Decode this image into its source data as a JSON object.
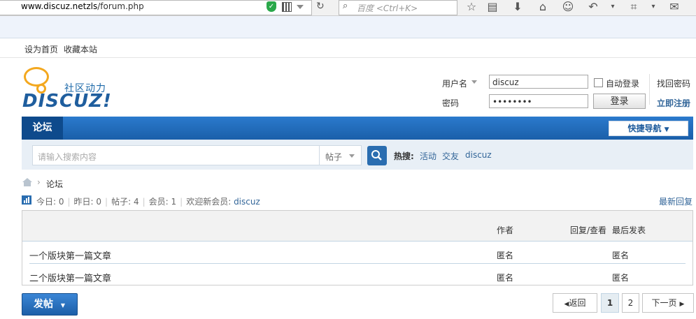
{
  "browser": {
    "url_host": "www.discuz.netzls",
    "url_path": "/forum.php",
    "search_placeholder": "百度 <Ctrl+K>"
  },
  "toplinks": [
    "设为首页",
    "收藏本站"
  ],
  "logo": {
    "slogan": "社区动力",
    "text": "DISCUZ!"
  },
  "login": {
    "username_label": "用户名",
    "username_value": "discuz",
    "password_label": "密码",
    "password_value": "••••••••",
    "autologin_label": "自动登录",
    "login_button": "登录",
    "find_password": "找回密码",
    "register": "立即注册"
  },
  "nav": {
    "active_tab": "论坛",
    "quicknav": "快捷导航"
  },
  "search": {
    "placeholder": "请输入搜索内容",
    "type": "帖子",
    "hot_label": "热搜:",
    "hot_items": [
      "活动",
      "交友",
      "discuz"
    ]
  },
  "breadcrumb": {
    "current": "论坛"
  },
  "stats": {
    "today": "今日: 0",
    "yesterday": "昨日: 0",
    "posts": "帖子: 4",
    "members": "会员: 1",
    "welcome": "欢迎新会员:",
    "new_member": "discuz",
    "latest_reply": "最新回复"
  },
  "table": {
    "headers": {
      "author": "作者",
      "replies": "回复/查看",
      "lastpost": "最后发表"
    },
    "rows": [
      {
        "title": "一个版块第一篇文章",
        "author": "匿名",
        "lastpost": "匿名"
      },
      {
        "title": "二个版块第一篇文章",
        "author": "匿名",
        "lastpost": "匿名"
      }
    ]
  },
  "footer": {
    "post_button": "发帖",
    "back": "返回",
    "pages": [
      "1",
      "2"
    ],
    "next": "下一页"
  },
  "colors": {
    "nav_blue": "#1f66b3",
    "link": "#336699",
    "logo_orange": "#f3a81f"
  }
}
